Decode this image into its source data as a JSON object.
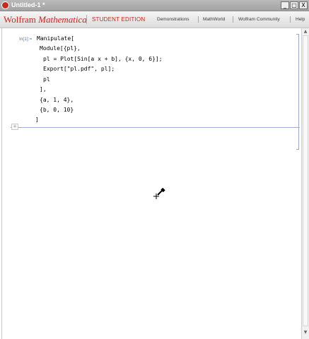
{
  "window": {
    "title": "Untitled-1 *",
    "buttons": {
      "minimize": "_",
      "maximize": "□",
      "close": "X"
    }
  },
  "banner": {
    "logo_wolfram": "Wolfram",
    "logo_mathematica": "Mathematica",
    "edition": "STUDENT EDITION",
    "links": [
      "Demonstrations",
      "MathWorld",
      "Wolfram Community",
      "Help"
    ]
  },
  "cell": {
    "label": "In[1]:=",
    "lines": [
      "Manipulate[",
      "Module[{pl},",
      "pl = Plot[Sin[a x + b], {x, 0, 6}];",
      "Export[\"pl.pdf\", pl];",
      "pl",
      "],",
      "{a, 1, 4},",
      "{b, 0, 10}",
      "]"
    ]
  },
  "insert_plus": "+",
  "colors": {
    "brand": "#c8261f",
    "label": "#5c78a8",
    "bracket": "#9aa9c7"
  }
}
